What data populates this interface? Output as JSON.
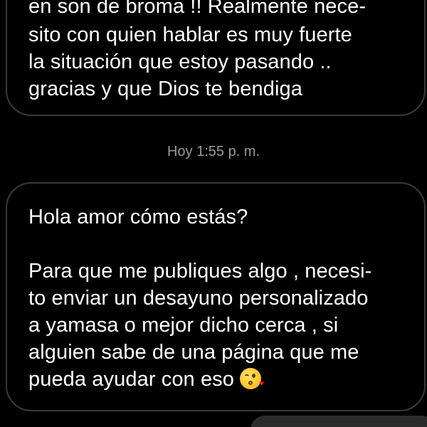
{
  "conversation": {
    "previous_message": {
      "lines": [
        "en son de broma !! Realmente nece-",
        "sito con quien hablar es muy fuerte",
        "la situación que estoy pasando ..",
        "gracias y que Dios te bendiga"
      ]
    },
    "timestamp": "Hoy 1:55 p. m.",
    "current_message": {
      "lines": [
        "Hola amor cómo estás?",
        "",
        "Para que me publiques algo , necesi-",
        "to enviar un desayuno personalizado",
        "a yamasa o mejor dicho cerca , si",
        "alguien sabe de una página que me",
        "pueda ayudar con eso"
      ],
      "emoji": "face-blowing-a-kiss"
    }
  },
  "colors": {
    "background": "#000000",
    "bubble_border": "#3a3a3a",
    "text": "#ffffff",
    "timestamp": "#9a9a9a",
    "outgoing_bubble": "#2b2b2b"
  }
}
